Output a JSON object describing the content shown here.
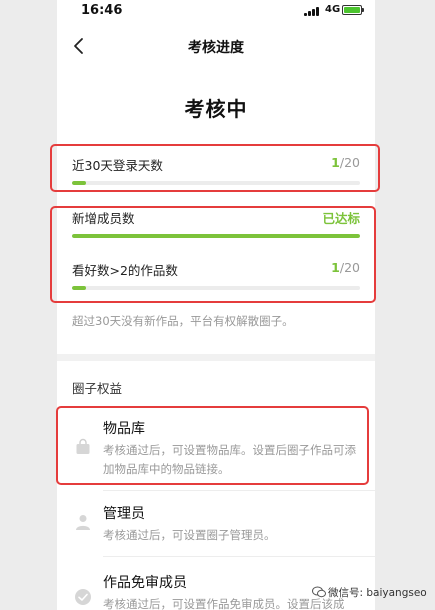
{
  "status_bar": {
    "time": "16:46",
    "network": "4G"
  },
  "nav": {
    "title": "考核进度"
  },
  "heading": "考核中",
  "progress_items": [
    {
      "label": "近30天登录天数",
      "current": "1",
      "separator_total": "/20",
      "status": "",
      "progress": 0.05
    },
    {
      "label": "新增成员数",
      "current": "",
      "separator_total": "",
      "status": "已达标",
      "progress": 1.0
    },
    {
      "label": "看好数>2的作品数",
      "current": "1",
      "separator_total": "/20",
      "status": "",
      "progress": 0.05
    }
  ],
  "note": "超过30天没有新作品，平台有权解散圈子。",
  "benefits_section": {
    "title": "圈子权益",
    "items": [
      {
        "title": "物品库",
        "desc": "考核通过后，可设置物品库。设置后圈子作品可添加物品库中的物品链接。",
        "icon": "bag-icon"
      },
      {
        "title": "管理员",
        "desc": "考核通过后，可设置圈子管理员。",
        "icon": "person-icon"
      },
      {
        "title": "作品免审成员",
        "desc": "考核通过后，可设置作品免审成员。设置后该成",
        "icon": "check-circle-icon"
      }
    ]
  },
  "watermark": "微信号: baiyangseo",
  "colors": {
    "accent_green": "#7cc33a",
    "highlight_red": "#e53c3c",
    "muted_text": "#999999"
  }
}
